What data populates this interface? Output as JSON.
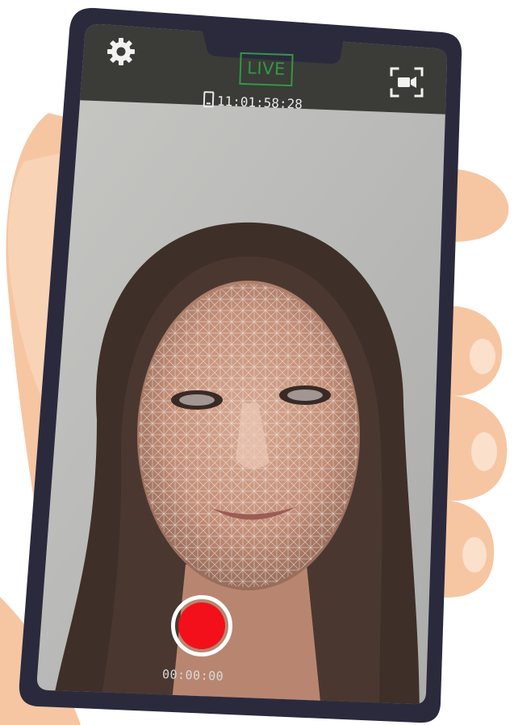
{
  "camera_app": {
    "live_label": "LIVE",
    "timecode": "11:01:58:28",
    "record_timer": "00:00:00",
    "icons": {
      "settings": "gear-icon",
      "device": "phone-icon",
      "switch_camera": "camera-switch-icon",
      "record": "record-button"
    },
    "colors": {
      "live_green": "#2e9a45",
      "record_red": "#f4101a",
      "top_bar": "#3b3b38",
      "phone_frame": "#2b2a3d"
    }
  }
}
